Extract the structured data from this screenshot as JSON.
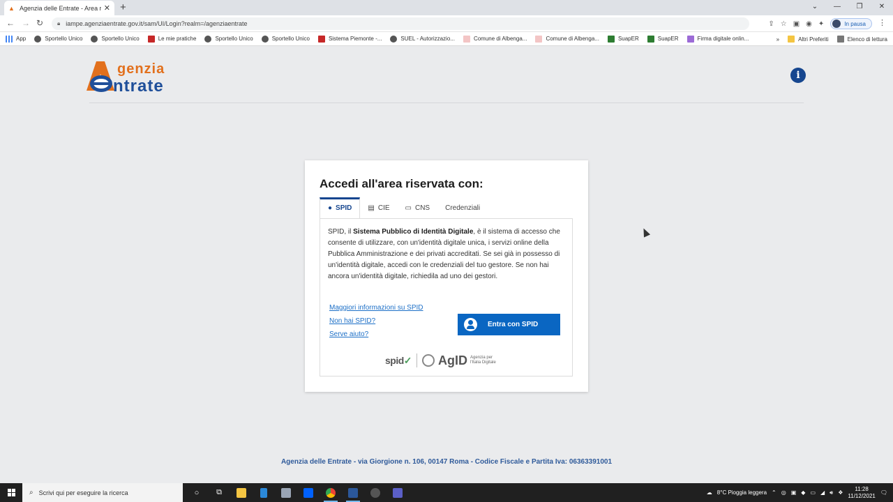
{
  "browser": {
    "tab_title": "Agenzia delle Entrate - Area rise",
    "tab_close": "✕",
    "new_tab": "+",
    "url": "iampe.agenziaentrate.gov.it/sam/UI/Login?realm=/agenziaentrate",
    "profile_label": "In pausa",
    "bookmarks": [
      {
        "label": "App",
        "icon": "apps-grid-icon"
      },
      {
        "label": "Sportello Unico",
        "icon": "globe-icon"
      },
      {
        "label": "Sportello Unico",
        "icon": "globe-icon"
      },
      {
        "label": "Le mie pratiche",
        "icon": "favicon"
      },
      {
        "label": "Sportello Unico",
        "icon": "globe-icon"
      },
      {
        "label": "Sportello Unico",
        "icon": "globe-icon"
      },
      {
        "label": "Sistema Piemonte -...",
        "icon": "favicon"
      },
      {
        "label": "SUEL - Autorizzazio...",
        "icon": "globe-icon"
      },
      {
        "label": "Comune di Albenga...",
        "icon": "favicon"
      },
      {
        "label": "Comune di Albenga...",
        "icon": "favicon"
      },
      {
        "label": "SuapER",
        "icon": "favicon"
      },
      {
        "label": "SuapER",
        "icon": "favicon"
      },
      {
        "label": "Firma digitale onlin...",
        "icon": "pen-icon"
      }
    ],
    "bookmarks_more": "»",
    "other_bookmarks": "Altri Preferiti",
    "reading_list": "Elenco di lettura"
  },
  "header": {
    "logo_line1": "genzia",
    "logo_line2": "ntrate",
    "info_icon": "i"
  },
  "login": {
    "title": "Accedi all'area riservata con:",
    "tabs": [
      {
        "label": "SPID",
        "icon": "user-circle-icon",
        "active": true
      },
      {
        "label": "CIE",
        "icon": "id-card-icon",
        "active": false
      },
      {
        "label": "CNS",
        "icon": "card-icon",
        "active": false
      },
      {
        "label": "Credenziali",
        "icon": "",
        "active": false
      }
    ],
    "desc_before": "SPID, il ",
    "desc_bold": "Sistema Pubblico di Identità Digitale",
    "desc_after": ", è il sistema di accesso che consente di utilizzare, con un'identità digitale unica, i servizi online della Pubblica Amministrazione e dei privati accreditati. Se sei già in possesso di un'identità digitale, accedi con le credenziali del tuo gestore. Se non hai ancora un'identità digitale, richiedila ad uno dei gestori.",
    "link_more": "Maggiori informazioni su SPID",
    "link_no_spid": "Non hai SPID?",
    "link_help": "Serve aiuto?",
    "button_label": "Entra con SPID",
    "spid_logo": "spid",
    "agid_logo": "AgID",
    "agid_sub": "Agenzia per l'Italia Digitale"
  },
  "footer": {
    "text": "Agenzia delle Entrate - via Giorgione n. 106, 00147 Roma - Codice Fiscale e Partita Iva: 06363391001"
  },
  "taskbar": {
    "search_placeholder": "Scrivi qui per eseguire la ricerca",
    "weather": "8°C  Pioggia leggera",
    "time": "11:28",
    "date": "11/12/2021"
  }
}
